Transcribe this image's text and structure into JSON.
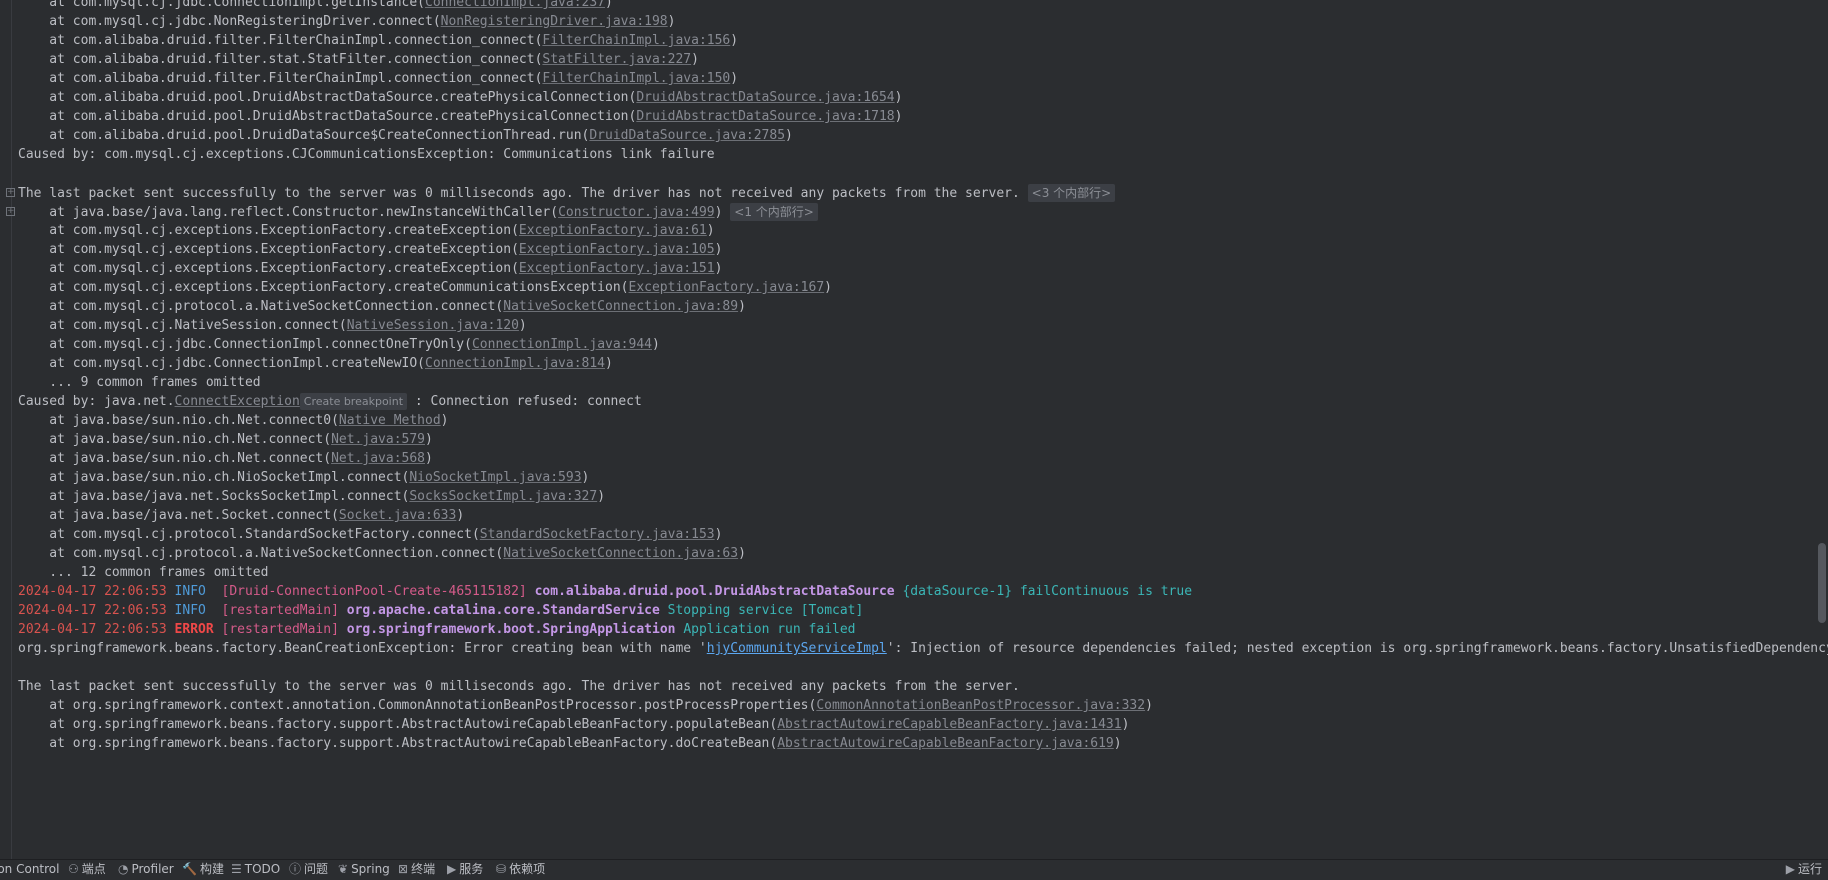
{
  "console": {
    "lines": [
      {
        "t": "frame",
        "indent": "    at ",
        "code": "com.mysql.cj.jdbc.ConnectionImpl.getInstance(",
        "link": "ConnectionImpl.java:237",
        "tail": ")"
      },
      {
        "t": "frame",
        "indent": "    at ",
        "code": "com.mysql.cj.jdbc.NonRegisteringDriver.connect(",
        "link": "NonRegisteringDriver.java:198",
        "tail": ")"
      },
      {
        "t": "frame",
        "indent": "    at ",
        "code": "com.alibaba.druid.filter.FilterChainImpl.connection_connect(",
        "link": "FilterChainImpl.java:156",
        "tail": ")"
      },
      {
        "t": "frame",
        "indent": "    at ",
        "code": "com.alibaba.druid.filter.stat.StatFilter.connection_connect(",
        "link": "StatFilter.java:227",
        "tail": ")"
      },
      {
        "t": "frame",
        "indent": "    at ",
        "code": "com.alibaba.druid.filter.FilterChainImpl.connection_connect(",
        "link": "FilterChainImpl.java:150",
        "tail": ")"
      },
      {
        "t": "frame",
        "indent": "    at ",
        "code": "com.alibaba.druid.pool.DruidAbstractDataSource.createPhysicalConnection(",
        "link": "DruidAbstractDataSource.java:1654",
        "tail": ")"
      },
      {
        "t": "frame",
        "indent": "    at ",
        "code": "com.alibaba.druid.pool.DruidAbstractDataSource.createPhysicalConnection(",
        "link": "DruidAbstractDataSource.java:1718",
        "tail": ")"
      },
      {
        "t": "frame",
        "indent": "    at ",
        "code": "com.alibaba.druid.pool.DruidDataSource$CreateConnectionThread.run(",
        "link": "DruidDataSource.java:2785",
        "tail": ")"
      },
      {
        "t": "plain",
        "text": "Caused by: com.mysql.cj.exceptions.CJCommunicationsException: Communications link failure"
      },
      {
        "t": "blank"
      },
      {
        "t": "plainpill",
        "fold": true,
        "text": "The last packet sent successfully to the server was 0 milliseconds ago. The driver has not received any packets from the server.",
        "pill": "<3 个内部行>"
      },
      {
        "t": "frame",
        "fold": true,
        "indent": "    at ",
        "code": "java.base/java.lang.reflect.Constructor.newInstanceWithCaller(",
        "link": "Constructor.java:499",
        "tail": ")",
        "pill": "<1 个内部行>"
      },
      {
        "t": "frame",
        "indent": "    at ",
        "code": "com.mysql.cj.exceptions.ExceptionFactory.createException(",
        "link": "ExceptionFactory.java:61",
        "tail": ")"
      },
      {
        "t": "frame",
        "indent": "    at ",
        "code": "com.mysql.cj.exceptions.ExceptionFactory.createException(",
        "link": "ExceptionFactory.java:105",
        "tail": ")"
      },
      {
        "t": "frame",
        "indent": "    at ",
        "code": "com.mysql.cj.exceptions.ExceptionFactory.createException(",
        "link": "ExceptionFactory.java:151",
        "tail": ")"
      },
      {
        "t": "frame",
        "indent": "    at ",
        "code": "com.mysql.cj.exceptions.ExceptionFactory.createCommunicationsException(",
        "link": "ExceptionFactory.java:167",
        "tail": ")"
      },
      {
        "t": "frame",
        "indent": "    at ",
        "code": "com.mysql.cj.protocol.a.NativeSocketConnection.connect(",
        "link": "NativeSocketConnection.java:89",
        "tail": ")"
      },
      {
        "t": "frame",
        "indent": "    at ",
        "code": "com.mysql.cj.NativeSession.connect(",
        "link": "NativeSession.java:120",
        "tail": ")"
      },
      {
        "t": "frame",
        "indent": "    at ",
        "code": "com.mysql.cj.jdbc.ConnectionImpl.connectOneTryOnly(",
        "link": "ConnectionImpl.java:944",
        "tail": ")"
      },
      {
        "t": "frame",
        "indent": "    at ",
        "code": "com.mysql.cj.jdbc.ConnectionImpl.createNewIO(",
        "link": "ConnectionImpl.java:814",
        "tail": ")"
      },
      {
        "t": "plain",
        "text": "    ... 9 common frames omitted"
      },
      {
        "t": "caused",
        "pre": "Caused by: java.net.",
        "link": "ConnectException",
        "bp": "Create breakpoint",
        "post": " : Connection refused: connect"
      },
      {
        "t": "frame",
        "indent": "    at ",
        "code": "java.base/sun.nio.ch.Net.connect0(",
        "link": "Native Method",
        "tail": ")"
      },
      {
        "t": "frame",
        "indent": "    at ",
        "code": "java.base/sun.nio.ch.Net.connect(",
        "link": "Net.java:579",
        "tail": ")"
      },
      {
        "t": "frame",
        "indent": "    at ",
        "code": "java.base/sun.nio.ch.Net.connect(",
        "link": "Net.java:568",
        "tail": ")"
      },
      {
        "t": "frame",
        "indent": "    at ",
        "code": "java.base/sun.nio.ch.NioSocketImpl.connect(",
        "link": "NioSocketImpl.java:593",
        "tail": ")"
      },
      {
        "t": "frame",
        "indent": "    at ",
        "code": "java.base/java.net.SocksSocketImpl.connect(",
        "link": "SocksSocketImpl.java:327",
        "tail": ")"
      },
      {
        "t": "frame",
        "indent": "    at ",
        "code": "java.base/java.net.Socket.connect(",
        "link": "Socket.java:633",
        "tail": ")"
      },
      {
        "t": "frame",
        "indent": "    at ",
        "code": "com.mysql.cj.protocol.StandardSocketFactory.connect(",
        "link": "StandardSocketFactory.java:153",
        "tail": ")"
      },
      {
        "t": "frame",
        "indent": "    at ",
        "code": "com.mysql.cj.protocol.a.NativeSocketConnection.connect(",
        "link": "NativeSocketConnection.java:63",
        "tail": ")"
      },
      {
        "t": "plain",
        "text": "    ... 12 common frames omitted"
      },
      {
        "t": "log",
        "ts": "2024-04-17 22:06:53",
        "level": "INFO ",
        "lvl": "info",
        "thread": "[Druid-ConnectionPool-Create-465115182]",
        "logger": "com.alibaba.druid.pool.DruidAbstractDataSource",
        "msg": "{dataSource-1} failContinuous is true"
      },
      {
        "t": "log",
        "ts": "2024-04-17 22:06:53",
        "level": "INFO ",
        "lvl": "info",
        "thread": "[restartedMain]",
        "logger": "org.apache.catalina.core.StandardService",
        "msg": "Stopping service [Tomcat]"
      },
      {
        "t": "log",
        "ts": "2024-04-17 22:06:53",
        "level": "ERROR",
        "lvl": "err",
        "thread": "[restartedMain]",
        "logger": "org.springframework.boot.SpringApplication",
        "msg": "Application run failed"
      },
      {
        "t": "beanerr",
        "pre": "org.springframework.beans.factory.BeanCreationException: Error creating bean with name '",
        "link": "hjyCommunityServiceImpl",
        "post": "': Injection of resource dependencies failed; nested exception is org.springframework.beans.factory.UnsatisfiedDependencyException"
      },
      {
        "t": "blank"
      },
      {
        "t": "plain",
        "text": "The last packet sent successfully to the server was 0 milliseconds ago. The driver has not received any packets from the server."
      },
      {
        "t": "frame",
        "indent": "    at ",
        "code": "org.springframework.context.annotation.CommonAnnotationBeanPostProcessor.postProcessProperties(",
        "link": "CommonAnnotationBeanPostProcessor.java:332",
        "tail": ")"
      },
      {
        "t": "frame",
        "indent": "    at ",
        "code": "org.springframework.beans.factory.support.AbstractAutowireCapableBeanFactory.populateBean(",
        "link": "AbstractAutowireCapableBeanFactory.java:1431",
        "tail": ")"
      },
      {
        "t": "frame",
        "indent": "    at ",
        "code": "org.springframework.beans.factory.support.AbstractAutowireCapableBeanFactory.doCreateBean(",
        "link": "AbstractAutowireCapableBeanFactory.java:619",
        "tail": ")"
      }
    ]
  },
  "statusbar": {
    "items": [
      {
        "label": "ion Control",
        "icon": ""
      },
      {
        "label": "端点",
        "icon": "⚇"
      },
      {
        "label": "Profiler",
        "icon": "◔"
      },
      {
        "label": "构建",
        "icon": "🔨"
      },
      {
        "label": "TODO",
        "icon": "☰"
      },
      {
        "label": "问题",
        "icon": "ⓘ"
      },
      {
        "label": "Spring",
        "icon": "❦"
      },
      {
        "label": "终端",
        "icon": "⊠"
      },
      {
        "label": "服务",
        "icon": "▶"
      },
      {
        "label": "依赖项",
        "icon": "⛁"
      }
    ],
    "run_label": "运行",
    "run_icon": "▶"
  },
  "colors": {
    "background": "#2b2d30",
    "text": "#bcbec4",
    "link": "#878a92",
    "error": "#f04848",
    "info": "#4f9bd9"
  }
}
